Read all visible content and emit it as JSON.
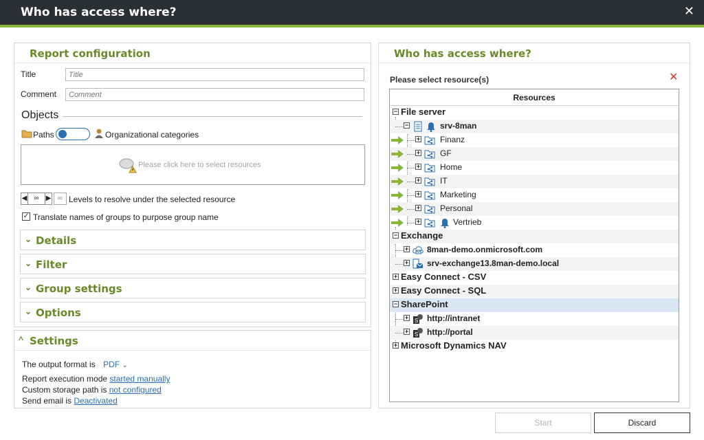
{
  "window": {
    "title": "Who has access where?",
    "close_icon": "close-icon"
  },
  "left": {
    "report_config_title": "Report configuration",
    "title_label": "Title",
    "title_placeholder": "Title",
    "comment_label": "Comment",
    "comment_placeholder": "Comment",
    "objects_heading": "Objects",
    "paths_label": "Paths",
    "org_label": "Organizational categories",
    "dropzone_hint": "Please click here to select resources",
    "levels_value": "∞",
    "levels_inf": "∞",
    "levels_label": "Levels to resolve under the selected resource",
    "translate_checked": true,
    "translate_label": "Translate names of groups to purpose group name",
    "sections": [
      "Details",
      "Filter",
      "Group settings",
      "Options"
    ],
    "settings_title": "Settings",
    "output_prefix": "The output format is",
    "output_value": "PDF",
    "exec_prefix": "Report execution mode",
    "exec_value": "started manually",
    "storage_prefix": "Custom storage path is",
    "storage_value": "not configured",
    "email_prefix": "Send email is",
    "email_value": "Deactivated"
  },
  "right": {
    "title": "Who has access where?",
    "select_label": "Please select resource(s)",
    "column_header": "Resources",
    "tree": {
      "file_server": "File server",
      "server": "srv-8man",
      "shares": [
        "Finanz",
        "GF",
        "Home",
        "IT",
        "Marketing",
        "Personal",
        "Vertrieb"
      ],
      "exchange": "Exchange",
      "exchange_items": [
        "8man-demo.onmicrosoft.com",
        "srv-exchange13.8man-demo.local"
      ],
      "csv": "Easy Connect - CSV",
      "sql": "Easy Connect - SQL",
      "sharepoint": "SharePoint",
      "sharepoint_items": [
        "http://intranet",
        "http://portal"
      ],
      "nav": "Microsoft Dynamics NAV"
    }
  },
  "buttons": {
    "start": "Start",
    "discard": "Discard"
  },
  "colors": {
    "accent": "#6a8a2a",
    "brand_green": "#8bb43a",
    "link": "#2a6fb5",
    "titlebar": "#2b2f33"
  }
}
